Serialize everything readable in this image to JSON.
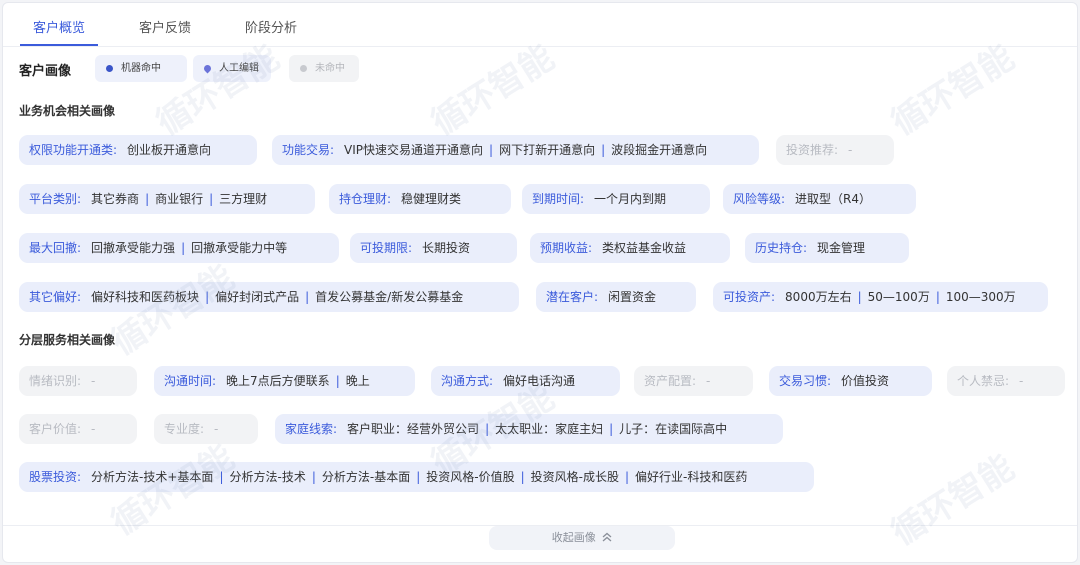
{
  "tabs": [
    {
      "label": "客户概览",
      "active": true
    },
    {
      "label": "客户反馈",
      "active": false
    },
    {
      "label": "阶段分析",
      "active": false
    }
  ],
  "profile": {
    "title": "客户画像",
    "legend": [
      {
        "label": "机器命中",
        "color": "#3a55c8"
      },
      {
        "label": "人工编辑",
        "color": "#6b73d9"
      },
      {
        "label": "未命中",
        "color": "#c8cacf"
      }
    ]
  },
  "section1": {
    "title": "业务机会相关画像",
    "tags": [
      {
        "key": "权限功能开通类:",
        "values": [
          "创业板开通意向"
        ]
      },
      {
        "key": "功能交易:",
        "values": [
          "VIP快速交易通道开通意向",
          "网下打新开通意向",
          "波段掘金开通意向"
        ]
      },
      {
        "key": "投资推荐:",
        "values": [
          "-"
        ],
        "muted": true
      },
      {
        "key": "平台类别:",
        "values": [
          "其它券商",
          "商业银行",
          "三方理财"
        ]
      },
      {
        "key": "持仓理财:",
        "values": [
          "稳健理财类"
        ]
      },
      {
        "key": "到期时间:",
        "values": [
          "一个月内到期"
        ]
      },
      {
        "key": "风险等级:",
        "values": [
          "进取型（R4）"
        ]
      },
      {
        "key": "最大回撤:",
        "values": [
          "回撤承受能力强",
          "回撤承受能力中等"
        ]
      },
      {
        "key": "可投期限:",
        "values": [
          "长期投资"
        ]
      },
      {
        "key": "预期收益:",
        "values": [
          "类权益基金收益"
        ]
      },
      {
        "key": "历史持仓:",
        "values": [
          "现金管理"
        ]
      },
      {
        "key": "其它偏好:",
        "values": [
          "偏好科技和医药板块",
          "偏好封闭式产品",
          "首发公募基金/新发公募基金"
        ]
      },
      {
        "key": "潜在客户:",
        "values": [
          "闲置资金"
        ]
      },
      {
        "key": "可投资产:",
        "values": [
          "8000万左右",
          "50—100万",
          "100—300万"
        ]
      }
    ]
  },
  "section2": {
    "title": "分层服务相关画像",
    "tags": [
      {
        "key": "情绪识别:",
        "values": [
          "-"
        ],
        "muted": true
      },
      {
        "key": "沟通时间:",
        "values": [
          "晚上7点后方便联系",
          "晚上"
        ]
      },
      {
        "key": "沟通方式:",
        "values": [
          "偏好电话沟通"
        ]
      },
      {
        "key": "资产配置:",
        "values": [
          "-"
        ],
        "muted": true
      },
      {
        "key": "交易习惯:",
        "values": [
          "价值投资"
        ]
      },
      {
        "key": "个人禁忌:",
        "values": [
          "-"
        ],
        "muted": true
      },
      {
        "key": "客户价值:",
        "values": [
          "-"
        ],
        "muted": true
      },
      {
        "key": "专业度:",
        "values": [
          "-"
        ],
        "muted": true
      },
      {
        "key": "家庭线索:",
        "values": [
          "客户职业：经营外贸公司",
          "太太职业：家庭主妇",
          "儿子：在读国际高中"
        ]
      },
      {
        "key": "股票投资:",
        "values": [
          "分析方法-技术+基本面",
          "分析方法-技术",
          "分析方法-基本面",
          "投资风格-价值股",
          "投资风格-成长股",
          "偏好行业-科技和医药"
        ]
      }
    ]
  },
  "collapse_label": "收起画像",
  "collapse_icon": "double-chevron-up-icon",
  "watermark_text": "循环智能"
}
